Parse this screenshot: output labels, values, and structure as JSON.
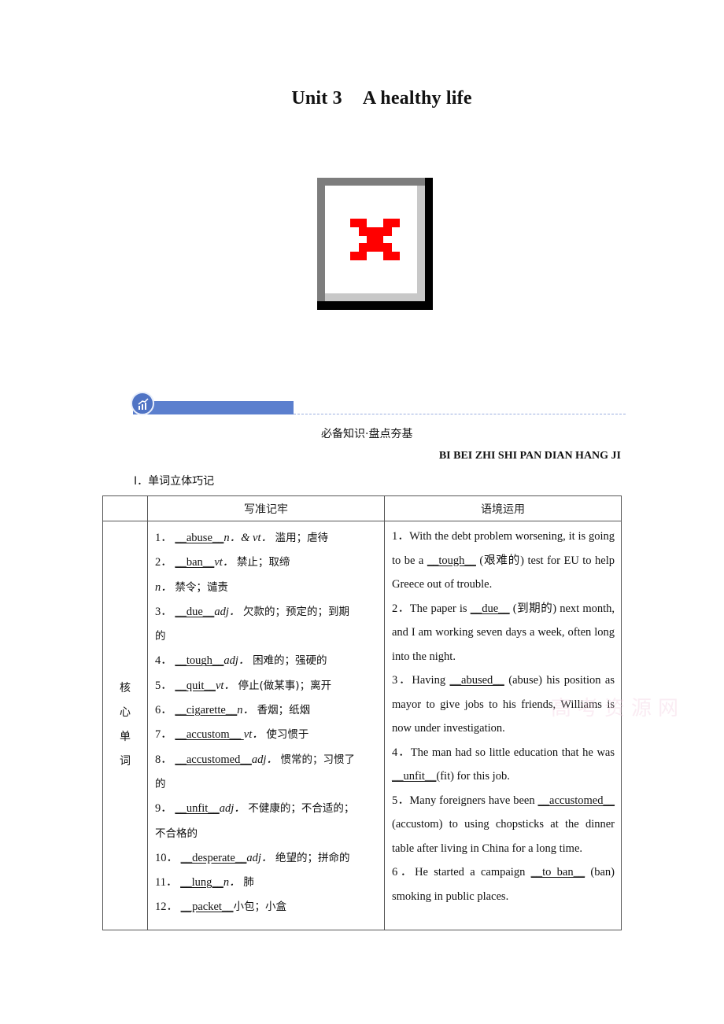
{
  "document": {
    "title_unit": "Unit 3",
    "title_name": "A healthy life"
  },
  "image": {
    "state": "broken-image placeholder",
    "icon": "red-x-icon",
    "accent_color": "#ff0000"
  },
  "section": {
    "banner_icon": "chart-growth-icon",
    "banner_color": "#5b7fce",
    "title_cn": "必备知识·盘点夯基",
    "title_en": "BI BEI ZHI SHI PAN DIAN HANG JI",
    "subsection": "Ⅰ．单词立体巧记"
  },
  "table": {
    "headers": [
      "",
      "写准记牢",
      "语境运用"
    ],
    "side_label": [
      "核",
      "心",
      "单",
      "词"
    ],
    "vocab": [
      {
        "num": "1．",
        "pre": "__",
        "word": "abuse",
        "post": "__",
        "pos": "n．& vt．",
        "meaning": "滥用；虐待"
      },
      {
        "num": "2．",
        "pre": "__",
        "word": "ban",
        "post": "__",
        "pos": "vt．",
        "meaning": "禁止；取缔"
      },
      {
        "num": "",
        "pre": "",
        "word": "",
        "post": "",
        "pos": "n．",
        "meaning": "禁令；谴责"
      },
      {
        "num": "3．",
        "pre": "__",
        "word": "due",
        "post": "__",
        "pos": "adj．",
        "meaning": "欠款的；预定的；到期"
      },
      {
        "num": "",
        "pre": "",
        "word": "",
        "post": "",
        "pos": "",
        "meaning": "的"
      },
      {
        "num": "4．",
        "pre": "__",
        "word": "tough",
        "post": "__",
        "pos": "adj．",
        "meaning": "困难的；强硬的"
      },
      {
        "num": "5．",
        "pre": "__",
        "word": "quit",
        "post": "__",
        "pos": "vt．",
        "meaning": "停止(做某事)；离开"
      },
      {
        "num": "6．",
        "pre": "__",
        "word": "cigarette",
        "post": "__",
        "pos": "n．",
        "meaning": "香烟；纸烟"
      },
      {
        "num": "7．",
        "pre": "__",
        "word": "accustom",
        "post": "__ ",
        "pos": "vt．",
        "meaning": "使习惯于"
      },
      {
        "num": "8．",
        "pre": "__",
        "word": "accustomed",
        "post": "__",
        "pos": "adj．",
        "meaning": "惯常的；习惯了"
      },
      {
        "num": "",
        "pre": "",
        "word": "",
        "post": "",
        "pos": "",
        "meaning": "的"
      },
      {
        "num": "9．",
        "pre": "__",
        "word": "unfit",
        "post": "__",
        "pos": "adj．",
        "meaning": "不健康的；不合适的；"
      },
      {
        "num": "",
        "pre": "",
        "word": "",
        "post": "",
        "pos": "",
        "meaning": "不合格的"
      },
      {
        "num": "10．",
        "pre": "__",
        "word": "desperate",
        "post": "__",
        "pos": "adj．",
        "meaning": " 绝望的；拼命的"
      },
      {
        "num": "11．",
        "pre": "__",
        "word": "lung",
        "post": "__",
        "pos": "n．",
        "meaning": " 肺"
      },
      {
        "num": "12．",
        "pre": "__",
        "word": "packet",
        "post": "__",
        "pos": "",
        "meaning": "小包；小盒"
      }
    ],
    "context": [
      {
        "before": "1．With the debt problem worsening, it is going to be a  __",
        "answer": "tough",
        "after": "__ (艰难的) test for EU to help Greece out of trouble."
      },
      {
        "before": "2．The paper is __",
        "answer": "due",
        "after": "__ (到期的) next month, and I am working seven days a week, often long into the night."
      },
      {
        "before": "3．Having __",
        "answer": "abused",
        "after": "__ (abuse) his position as mayor to give jobs to his friends, Williams is now under investigation."
      },
      {
        "before": "4．The man had so little education that he was __",
        "answer": "unfit",
        "after": "__(fit) for this job."
      },
      {
        "before": "5．Many foreigners have been __",
        "answer": "accustomed",
        "after": "__ (accustom) to using chopsticks at the dinner table after living in China for a long time."
      },
      {
        "before": "6．He started a campaign __",
        "answer": "to ban",
        "after": "__ (ban) smoking in public places."
      }
    ]
  }
}
